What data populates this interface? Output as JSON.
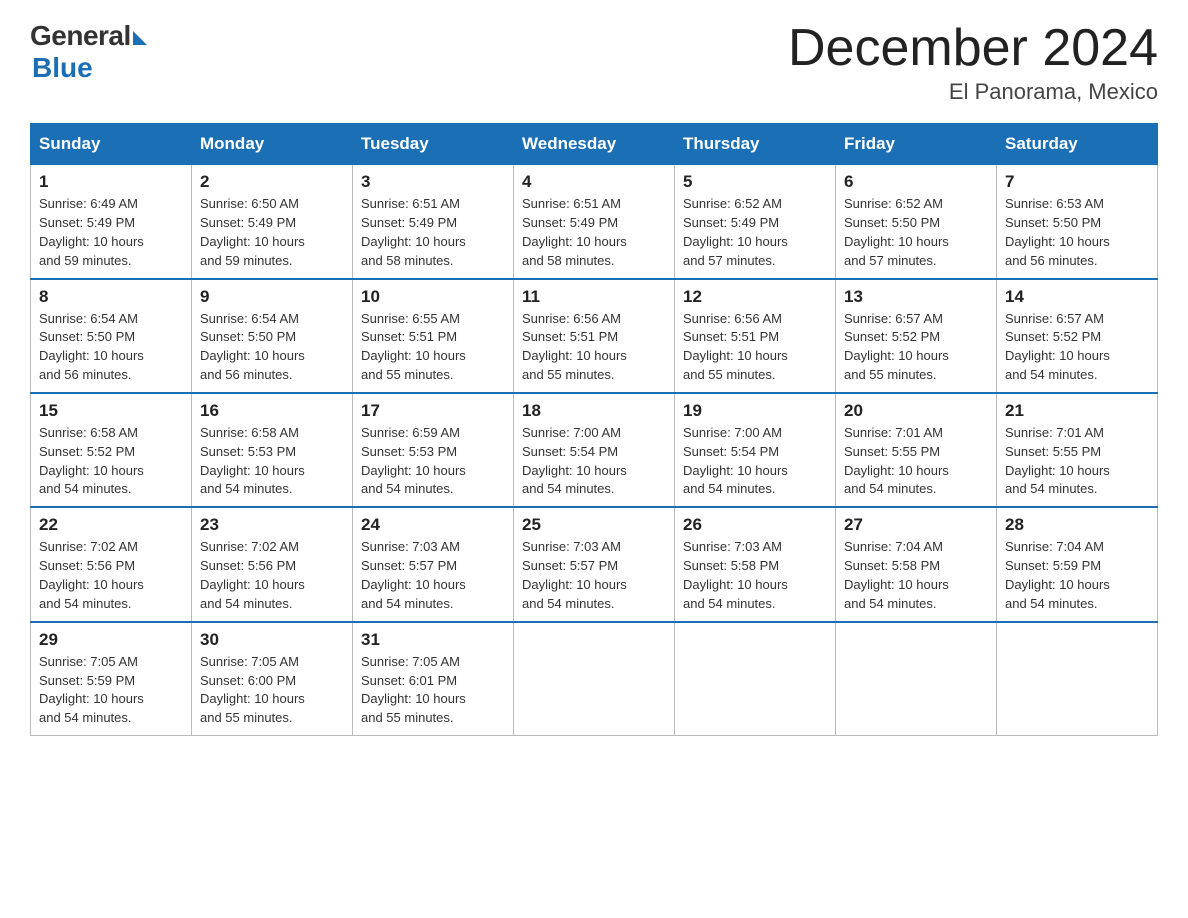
{
  "header": {
    "logo_general": "General",
    "logo_blue": "Blue",
    "month_title": "December 2024",
    "location": "El Panorama, Mexico"
  },
  "days_of_week": [
    "Sunday",
    "Monday",
    "Tuesday",
    "Wednesday",
    "Thursday",
    "Friday",
    "Saturday"
  ],
  "weeks": [
    [
      {
        "day": "1",
        "sunrise": "6:49 AM",
        "sunset": "5:49 PM",
        "daylight": "10 hours and 59 minutes."
      },
      {
        "day": "2",
        "sunrise": "6:50 AM",
        "sunset": "5:49 PM",
        "daylight": "10 hours and 59 minutes."
      },
      {
        "day": "3",
        "sunrise": "6:51 AM",
        "sunset": "5:49 PM",
        "daylight": "10 hours and 58 minutes."
      },
      {
        "day": "4",
        "sunrise": "6:51 AM",
        "sunset": "5:49 PM",
        "daylight": "10 hours and 58 minutes."
      },
      {
        "day": "5",
        "sunrise": "6:52 AM",
        "sunset": "5:49 PM",
        "daylight": "10 hours and 57 minutes."
      },
      {
        "day": "6",
        "sunrise": "6:52 AM",
        "sunset": "5:50 PM",
        "daylight": "10 hours and 57 minutes."
      },
      {
        "day": "7",
        "sunrise": "6:53 AM",
        "sunset": "5:50 PM",
        "daylight": "10 hours and 56 minutes."
      }
    ],
    [
      {
        "day": "8",
        "sunrise": "6:54 AM",
        "sunset": "5:50 PM",
        "daylight": "10 hours and 56 minutes."
      },
      {
        "day": "9",
        "sunrise": "6:54 AM",
        "sunset": "5:50 PM",
        "daylight": "10 hours and 56 minutes."
      },
      {
        "day": "10",
        "sunrise": "6:55 AM",
        "sunset": "5:51 PM",
        "daylight": "10 hours and 55 minutes."
      },
      {
        "day": "11",
        "sunrise": "6:56 AM",
        "sunset": "5:51 PM",
        "daylight": "10 hours and 55 minutes."
      },
      {
        "day": "12",
        "sunrise": "6:56 AM",
        "sunset": "5:51 PM",
        "daylight": "10 hours and 55 minutes."
      },
      {
        "day": "13",
        "sunrise": "6:57 AM",
        "sunset": "5:52 PM",
        "daylight": "10 hours and 55 minutes."
      },
      {
        "day": "14",
        "sunrise": "6:57 AM",
        "sunset": "5:52 PM",
        "daylight": "10 hours and 54 minutes."
      }
    ],
    [
      {
        "day": "15",
        "sunrise": "6:58 AM",
        "sunset": "5:52 PM",
        "daylight": "10 hours and 54 minutes."
      },
      {
        "day": "16",
        "sunrise": "6:58 AM",
        "sunset": "5:53 PM",
        "daylight": "10 hours and 54 minutes."
      },
      {
        "day": "17",
        "sunrise": "6:59 AM",
        "sunset": "5:53 PM",
        "daylight": "10 hours and 54 minutes."
      },
      {
        "day": "18",
        "sunrise": "7:00 AM",
        "sunset": "5:54 PM",
        "daylight": "10 hours and 54 minutes."
      },
      {
        "day": "19",
        "sunrise": "7:00 AM",
        "sunset": "5:54 PM",
        "daylight": "10 hours and 54 minutes."
      },
      {
        "day": "20",
        "sunrise": "7:01 AM",
        "sunset": "5:55 PM",
        "daylight": "10 hours and 54 minutes."
      },
      {
        "day": "21",
        "sunrise": "7:01 AM",
        "sunset": "5:55 PM",
        "daylight": "10 hours and 54 minutes."
      }
    ],
    [
      {
        "day": "22",
        "sunrise": "7:02 AM",
        "sunset": "5:56 PM",
        "daylight": "10 hours and 54 minutes."
      },
      {
        "day": "23",
        "sunrise": "7:02 AM",
        "sunset": "5:56 PM",
        "daylight": "10 hours and 54 minutes."
      },
      {
        "day": "24",
        "sunrise": "7:03 AM",
        "sunset": "5:57 PM",
        "daylight": "10 hours and 54 minutes."
      },
      {
        "day": "25",
        "sunrise": "7:03 AM",
        "sunset": "5:57 PM",
        "daylight": "10 hours and 54 minutes."
      },
      {
        "day": "26",
        "sunrise": "7:03 AM",
        "sunset": "5:58 PM",
        "daylight": "10 hours and 54 minutes."
      },
      {
        "day": "27",
        "sunrise": "7:04 AM",
        "sunset": "5:58 PM",
        "daylight": "10 hours and 54 minutes."
      },
      {
        "day": "28",
        "sunrise": "7:04 AM",
        "sunset": "5:59 PM",
        "daylight": "10 hours and 54 minutes."
      }
    ],
    [
      {
        "day": "29",
        "sunrise": "7:05 AM",
        "sunset": "5:59 PM",
        "daylight": "10 hours and 54 minutes."
      },
      {
        "day": "30",
        "sunrise": "7:05 AM",
        "sunset": "6:00 PM",
        "daylight": "10 hours and 55 minutes."
      },
      {
        "day": "31",
        "sunrise": "7:05 AM",
        "sunset": "6:01 PM",
        "daylight": "10 hours and 55 minutes."
      },
      null,
      null,
      null,
      null
    ]
  ]
}
